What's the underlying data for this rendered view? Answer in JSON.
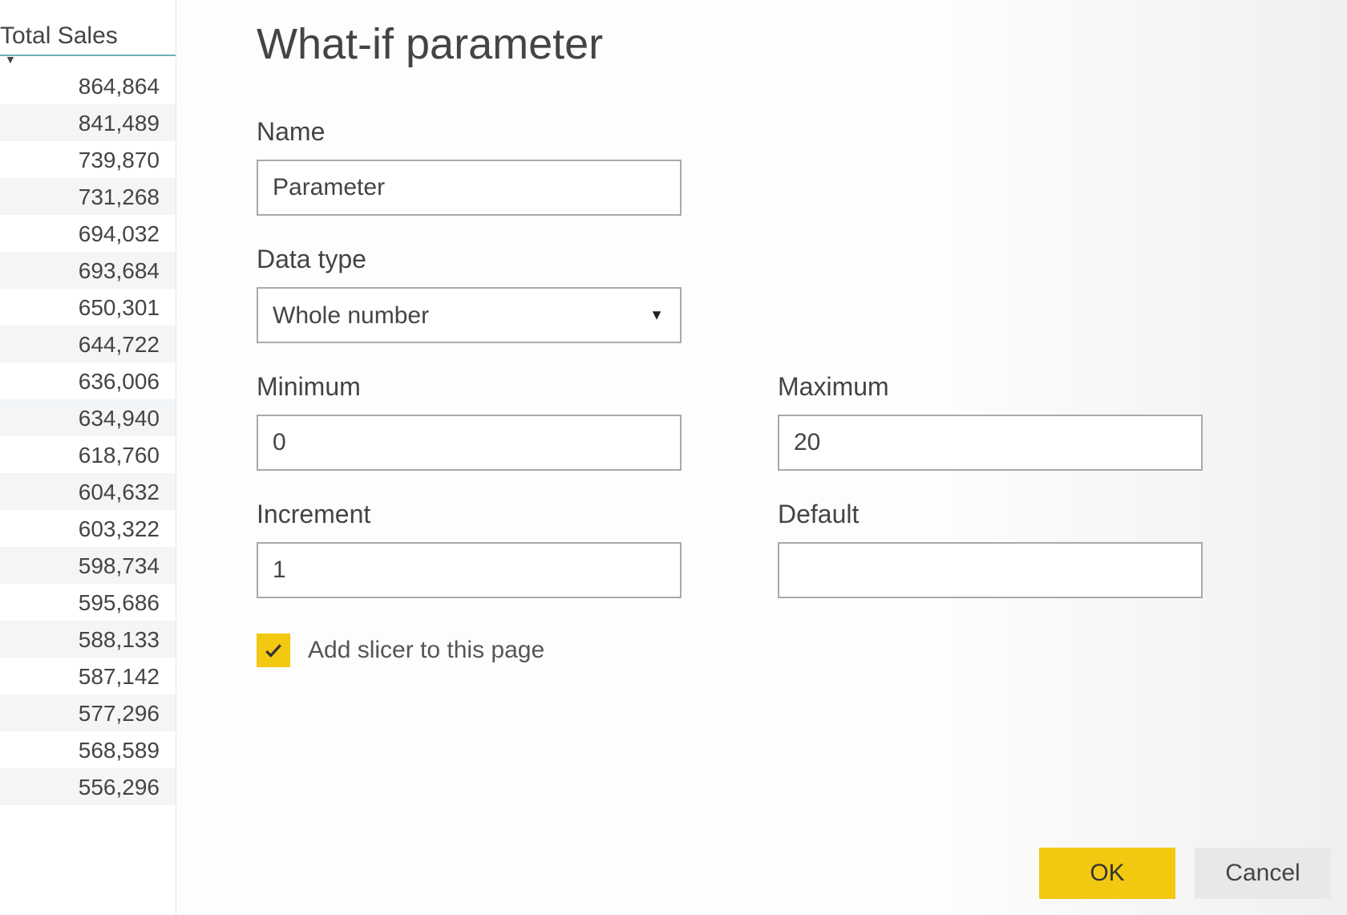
{
  "table": {
    "header": "Total Sales",
    "sort_direction": "desc",
    "values": [
      "864,864",
      "841,489",
      "739,870",
      "731,268",
      "694,032",
      "693,684",
      "650,301",
      "644,722",
      "636,006",
      "634,940",
      "618,760",
      "604,632",
      "603,322",
      "598,734",
      "595,686",
      "588,133",
      "587,142",
      "577,296",
      "568,589",
      "556,296"
    ]
  },
  "dialog": {
    "title": "What-if parameter",
    "labels": {
      "name": "Name",
      "data_type": "Data type",
      "minimum": "Minimum",
      "maximum": "Maximum",
      "increment": "Increment",
      "default": "Default",
      "add_slicer": "Add slicer to this page"
    },
    "values": {
      "name": "Parameter",
      "data_type": "Whole number",
      "minimum": "0",
      "maximum": "20",
      "increment": "1",
      "default": ""
    },
    "add_slicer_checked": true,
    "buttons": {
      "ok": "OK",
      "cancel": "Cancel"
    }
  }
}
